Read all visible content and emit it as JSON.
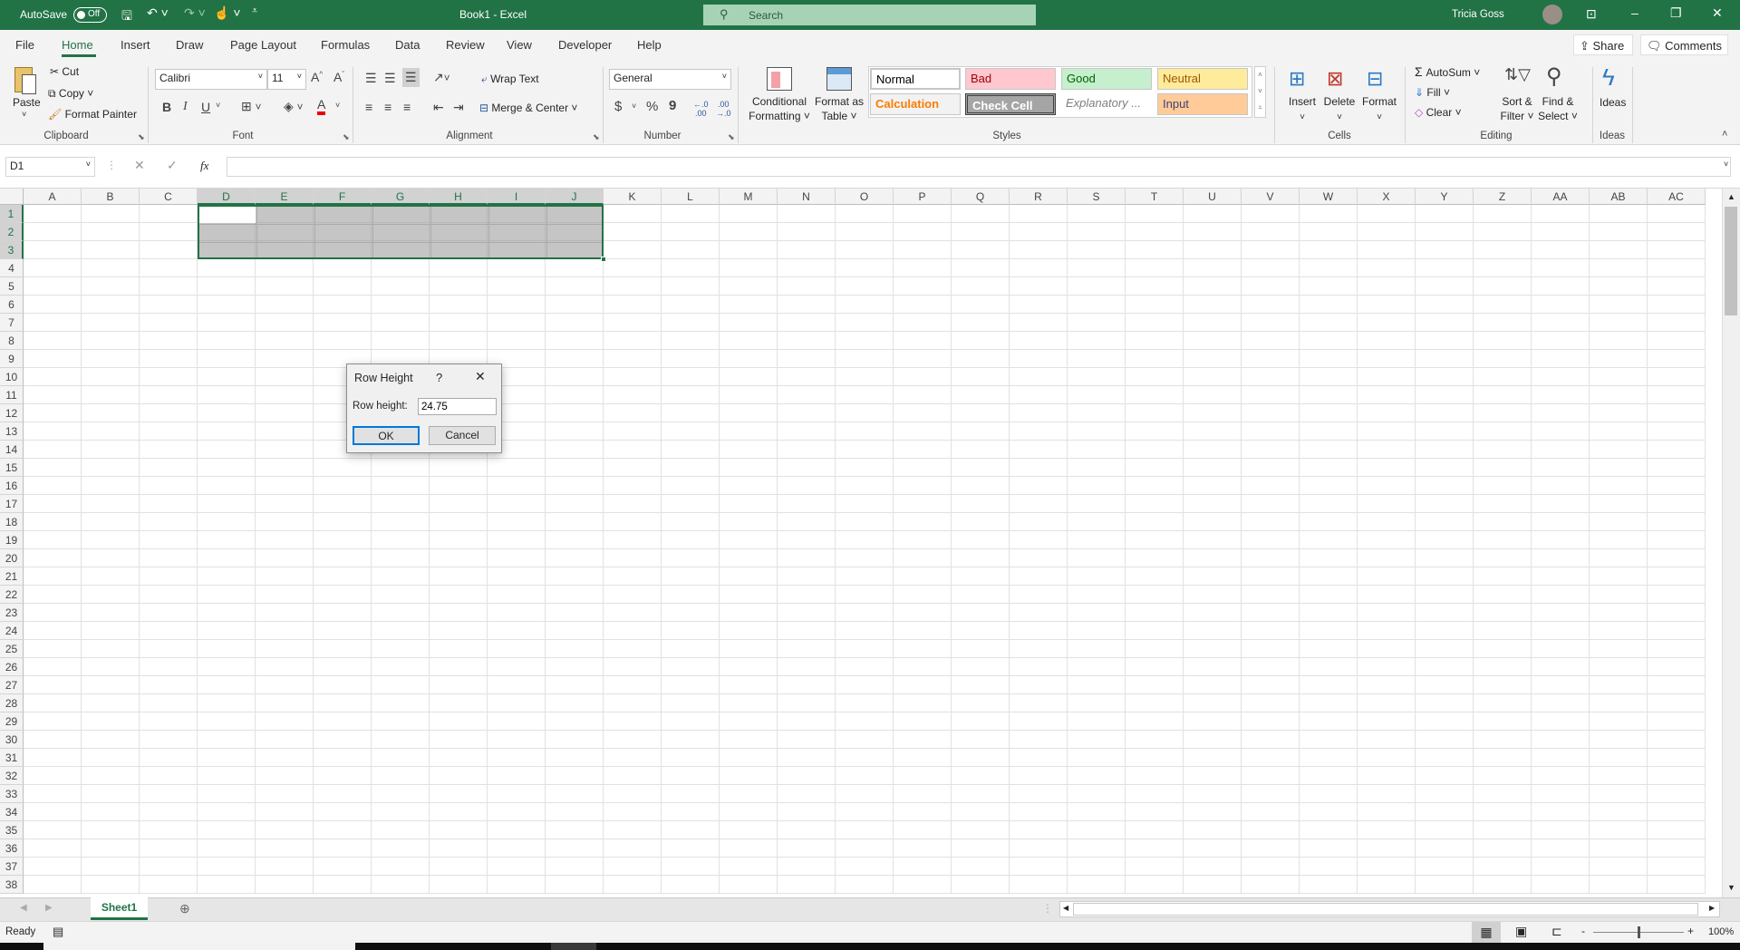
{
  "titlebar": {
    "autosave_label": "AutoSave",
    "autosave_state": "Off",
    "title": "Book1  -  Excel",
    "search_placeholder": "Search",
    "user_name": "Tricia Goss"
  },
  "tabs": [
    "File",
    "Home",
    "Insert",
    "Draw",
    "Page Layout",
    "Formulas",
    "Data",
    "Review",
    "View",
    "Developer",
    "Help"
  ],
  "active_tab": "Home",
  "share_label": "Share",
  "comments_label": "Comments",
  "clipboard": {
    "paste": "Paste",
    "cut": "Cut",
    "copy": "Copy",
    "format_painter": "Format Painter",
    "label": "Clipboard"
  },
  "font": {
    "name": "Calibri",
    "size": "11",
    "bold": "B",
    "italic": "I",
    "underline": "U",
    "label": "Font"
  },
  "alignment": {
    "wrap_text": "Wrap Text",
    "merge_center": "Merge & Center",
    "label": "Alignment"
  },
  "number": {
    "format": "General",
    "currency": "$",
    "percent": "%",
    "comma": "9",
    "label": "Number"
  },
  "styles": {
    "conditional_formatting": [
      "Conditional",
      "Formatting"
    ],
    "format_as_table": [
      "Format as",
      "Table"
    ],
    "label": "Styles",
    "cells": [
      {
        "name": "Normal",
        "bg": "#ffffff",
        "fg": "#000000"
      },
      {
        "name": "Bad",
        "bg": "#ffc7ce",
        "fg": "#9c0006"
      },
      {
        "name": "Good",
        "bg": "#c6efce",
        "fg": "#006100"
      },
      {
        "name": "Neutral",
        "bg": "#ffeb9c",
        "fg": "#9c5700"
      },
      {
        "name": "Calculation",
        "bg": "#f2f2f2",
        "fg": "#fa7d00"
      },
      {
        "name": "Check Cell",
        "bg": "#a5a5a5",
        "fg": "#ffffff"
      },
      {
        "name": "Explanatory ...",
        "bg": "#ffffff",
        "fg": "#7f7f7f"
      },
      {
        "name": "Input",
        "bg": "#ffcc99",
        "fg": "#3f3f76"
      }
    ]
  },
  "cells_group": {
    "insert": "Insert",
    "delete": "Delete",
    "format": "Format",
    "label": "Cells"
  },
  "editing": {
    "autosum": "AutoSum",
    "fill": "Fill",
    "clear": "Clear",
    "sort_filter": [
      "Sort &",
      "Filter"
    ],
    "find_select": [
      "Find &",
      "Select"
    ],
    "label": "Editing"
  },
  "ideas": {
    "button": "Ideas",
    "label": "Ideas"
  },
  "formula_bar": {
    "name_box": "D1",
    "value": "",
    "fx": "fx"
  },
  "columns": [
    "A",
    "B",
    "C",
    "D",
    "E",
    "F",
    "G",
    "H",
    "I",
    "J",
    "K",
    "L",
    "M",
    "N",
    "O",
    "P",
    "Q",
    "R",
    "S",
    "T",
    "U",
    "V",
    "W",
    "X",
    "Y",
    "Z",
    "AA",
    "AB",
    "AC"
  ],
  "rows": [
    1,
    2,
    3,
    4,
    5,
    6,
    7,
    8,
    9,
    10,
    11,
    12,
    13,
    14,
    15,
    16,
    17,
    18,
    19,
    20,
    21,
    22,
    23,
    24,
    25,
    26,
    27,
    28,
    29,
    30,
    31,
    32,
    33,
    34,
    35,
    36,
    37,
    38
  ],
  "selection": {
    "range": "D1:J3",
    "columns": [
      "D",
      "E",
      "F",
      "G",
      "H",
      "I",
      "J"
    ],
    "rows": [
      1,
      2,
      3
    ]
  },
  "dialog": {
    "title": "Row Height",
    "help": "?",
    "label": "Row height:",
    "value": "24.75",
    "ok": "OK",
    "cancel": "Cancel"
  },
  "sheets": [
    {
      "name": "Sheet1",
      "active": true
    }
  ],
  "status": {
    "ready": "Ready",
    "zoom": "100%"
  },
  "colors": {
    "accent": "#217346"
  }
}
